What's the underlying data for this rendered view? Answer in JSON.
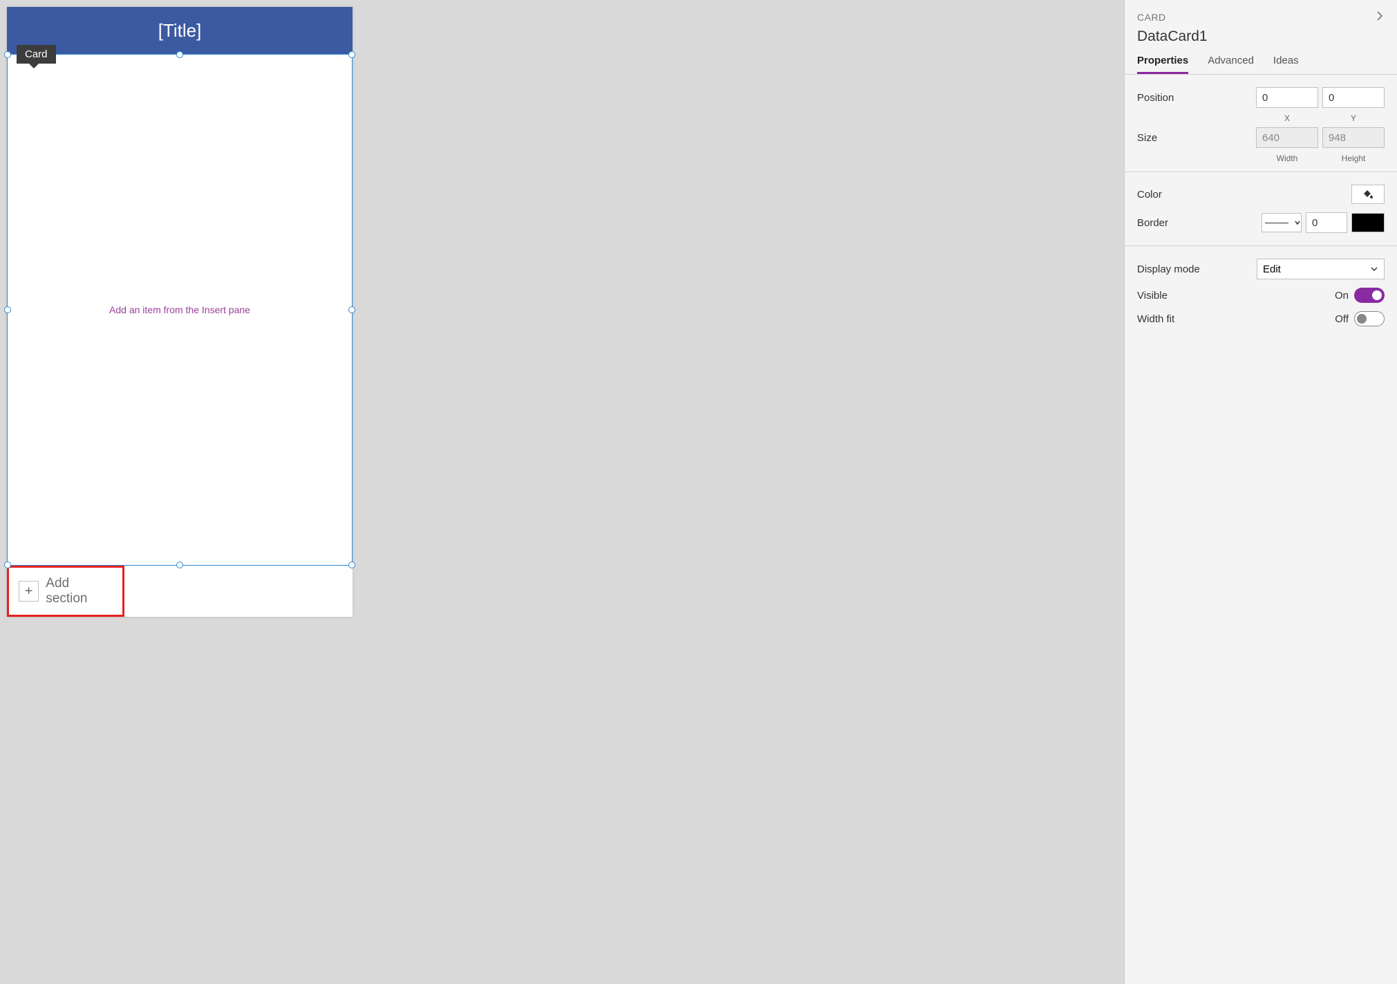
{
  "canvas": {
    "tooltip": "Card",
    "header_title": "[Title]",
    "placeholder": "Add an item from the Insert pane",
    "add_section_label": "Add section"
  },
  "panel": {
    "category": "CARD",
    "title": "DataCard1",
    "tabs": {
      "properties": "Properties",
      "advanced": "Advanced",
      "ideas": "Ideas"
    },
    "props": {
      "position_label": "Position",
      "position_x": "0",
      "position_y": "0",
      "x_label": "X",
      "y_label": "Y",
      "size_label": "Size",
      "size_w": "640",
      "size_h": "948",
      "width_label": "Width",
      "height_label": "Height",
      "color_label": "Color",
      "border_label": "Border",
      "border_value": "0",
      "display_mode_label": "Display mode",
      "display_mode_value": "Edit",
      "visible_label": "Visible",
      "visible_value": "On",
      "widthfit_label": "Width fit",
      "widthfit_value": "Off"
    }
  }
}
